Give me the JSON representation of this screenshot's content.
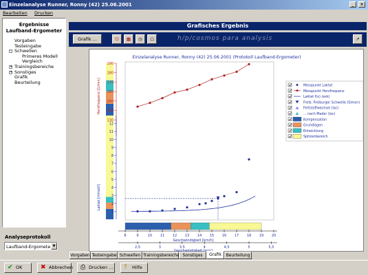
{
  "window": {
    "title": "Einzelanalyse Runner, Ronny (42) 25.06.2001"
  },
  "menu": [
    "Bearbeiten",
    "Drucken"
  ],
  "left": {
    "header_line1": "Ergebnisse",
    "header_line2": "Laufband-Ergometer",
    "tree": [
      {
        "label": "Vorgaben",
        "level": 1,
        "box": ""
      },
      {
        "label": "Testeingabe",
        "level": 1,
        "box": ""
      },
      {
        "label": "Schwellen",
        "level": 1,
        "box": "-"
      },
      {
        "label": "Primeres Modell",
        "level": 2,
        "box": ""
      },
      {
        "label": "Vergleich",
        "level": 2,
        "box": ""
      },
      {
        "label": "Trainingsbereiche",
        "level": 1,
        "box": "+"
      },
      {
        "label": "Sonstiges",
        "level": 1,
        "box": "+"
      },
      {
        "label": "Grafik",
        "level": 1,
        "box": ""
      },
      {
        "label": "Beurteilung",
        "level": 1,
        "box": ""
      }
    ],
    "analyse_label": "Analyseprotokoll",
    "analyse_value": "Laufband-Ergometer"
  },
  "panel": {
    "title": "Grafisches Ergebnis",
    "grafik_button": "Grafik ...",
    "brand": "h/p/cosmos para analysis"
  },
  "chart_data": {
    "type": "line",
    "title": "Einzelanalyse Runner, Ronny (42) 25.06.2001 (Protokoll Laufband-Ergometer)",
    "xlabel": "Geschwindigkeit [km/h]",
    "xlabel2": "Geschwindigkeit [m/s]",
    "ylabel_hr": "Herzfrequenz [1/min]",
    "ylabel_lactate": "Laktat [mmol/l]",
    "xlim": [
      8,
      20
    ],
    "xticks": [
      8,
      9,
      10,
      11,
      12,
      13,
      14,
      15,
      16,
      17,
      18,
      19,
      20
    ],
    "x2ticks": [
      "2,5",
      "3",
      "3,5",
      "4",
      "4,5",
      "5",
      "5,5"
    ],
    "x2tickvals": [
      2.5,
      3,
      3.5,
      4,
      4.5,
      5,
      5.5
    ],
    "hr_ylim": [
      120,
      190
    ],
    "hr_ticks": [
      130,
      140,
      150,
      160,
      170,
      180,
      190
    ],
    "lactate_ylim": [
      0,
      13
    ],
    "lactate_ticks": [
      1,
      2,
      3,
      4,
      5,
      6,
      7,
      8,
      9,
      10,
      11,
      12
    ],
    "series": [
      {
        "name": "Messpunkt Laktat",
        "color": "#1f2f9f",
        "x": [
          9,
          10,
          11,
          12,
          13,
          14,
          14.5,
          15,
          15.5,
          16,
          17,
          18
        ],
        "values": [
          1.0,
          1.0,
          1.1,
          1.3,
          1.5,
          1.9,
          2.0,
          2.3,
          2.6,
          2.9,
          3.4,
          7.5
        ]
      },
      {
        "name": "Messpunkt Herzfrequenz",
        "color": "#b02020",
        "x": [
          9,
          10,
          11,
          12,
          13,
          14,
          15,
          16,
          17,
          18
        ],
        "values": [
          144,
          148,
          153,
          159,
          162,
          167,
          173,
          177,
          181,
          189
        ]
      }
    ],
    "lactate_curve": {
      "a": 0.98,
      "b": 0.0119,
      "c": 0.485,
      "color": "#1f2f9f"
    },
    "threshold": {
      "x": 15.5,
      "y": 2.6,
      "label": "Freib. Freiburger Schwelle (Simon)"
    },
    "zones": [
      {
        "name": "Kompensation",
        "color": "#2b5fae",
        "x0": 8,
        "x1": 11.7
      },
      {
        "name": "Grundlagen",
        "color": "#e9925a",
        "x0": 11.7,
        "x1": 13.3
      },
      {
        "name": "Entwicklung",
        "color": "#38bfc1",
        "x0": 13.3,
        "x1": 14.8
      },
      {
        "name": "Spitzenbereich",
        "color": "#f8f894",
        "x0": 14.8,
        "x1": 19
      }
    ],
    "lactate_bands": [
      {
        "color": "#2b5fae",
        "y0": 0,
        "y1": 1.3
      },
      {
        "color": "#e9925a",
        "y0": 1.3,
        "y1": 2.1
      },
      {
        "color": "#38bfc1",
        "y0": 2.1,
        "y1": 2.8
      },
      {
        "color": "#f8f894",
        "y0": 2.8,
        "y1": 13
      }
    ],
    "hr_bands": [
      {
        "color": "#2b5fae",
        "y0": 120,
        "y1": 147
      },
      {
        "color": "#e9925a",
        "y0": 147,
        "y1": 160
      },
      {
        "color": "#38bfc1",
        "y0": 160,
        "y1": 172
      },
      {
        "color": "#f8f894",
        "y0": 172,
        "y1": 190
      }
    ],
    "legend": [
      {
        "label": "Messpunkt Laktat",
        "kind": "dot",
        "color": "#1f2f9f"
      },
      {
        "label": "Messpunkt Herzfrequenz",
        "kind": "line-dot",
        "color": "#b02020"
      },
      {
        "label": "Laktat f(x) (exk)",
        "kind": "line",
        "color": "#1f2f9f"
      },
      {
        "label": "Freib. Freiburger Schwelle (Simon)",
        "kind": "tri-down",
        "color": "#1f2f9f"
      },
      {
        "label": "Fettstoffwechsel (lac)",
        "kind": "tri-up",
        "color": "#8080ff"
      },
      {
        "label": "... nach Mader (lac)",
        "kind": "tri-up",
        "color": "#38bfc1"
      },
      {
        "label": "Kompensation",
        "kind": "box",
        "color": "#2b5fae"
      },
      {
        "label": "Grundlagen",
        "kind": "box",
        "color": "#e9925a"
      },
      {
        "label": "Entwicklung",
        "kind": "box",
        "color": "#38bfc1"
      },
      {
        "label": "Spitzenbereich",
        "kind": "box",
        "color": "#f8f894"
      }
    ]
  },
  "tabs": [
    "Vorgaben",
    "Testeingabe",
    "Schwellen",
    "Trainingsbereiche",
    "Sonstiges",
    "Grafik",
    "Beurteilung"
  ],
  "active_tab": "Grafik",
  "buttons": {
    "ok": "OK",
    "cancel": "Abbrechen",
    "print": "Drucken ...",
    "help": "Hilfe"
  }
}
